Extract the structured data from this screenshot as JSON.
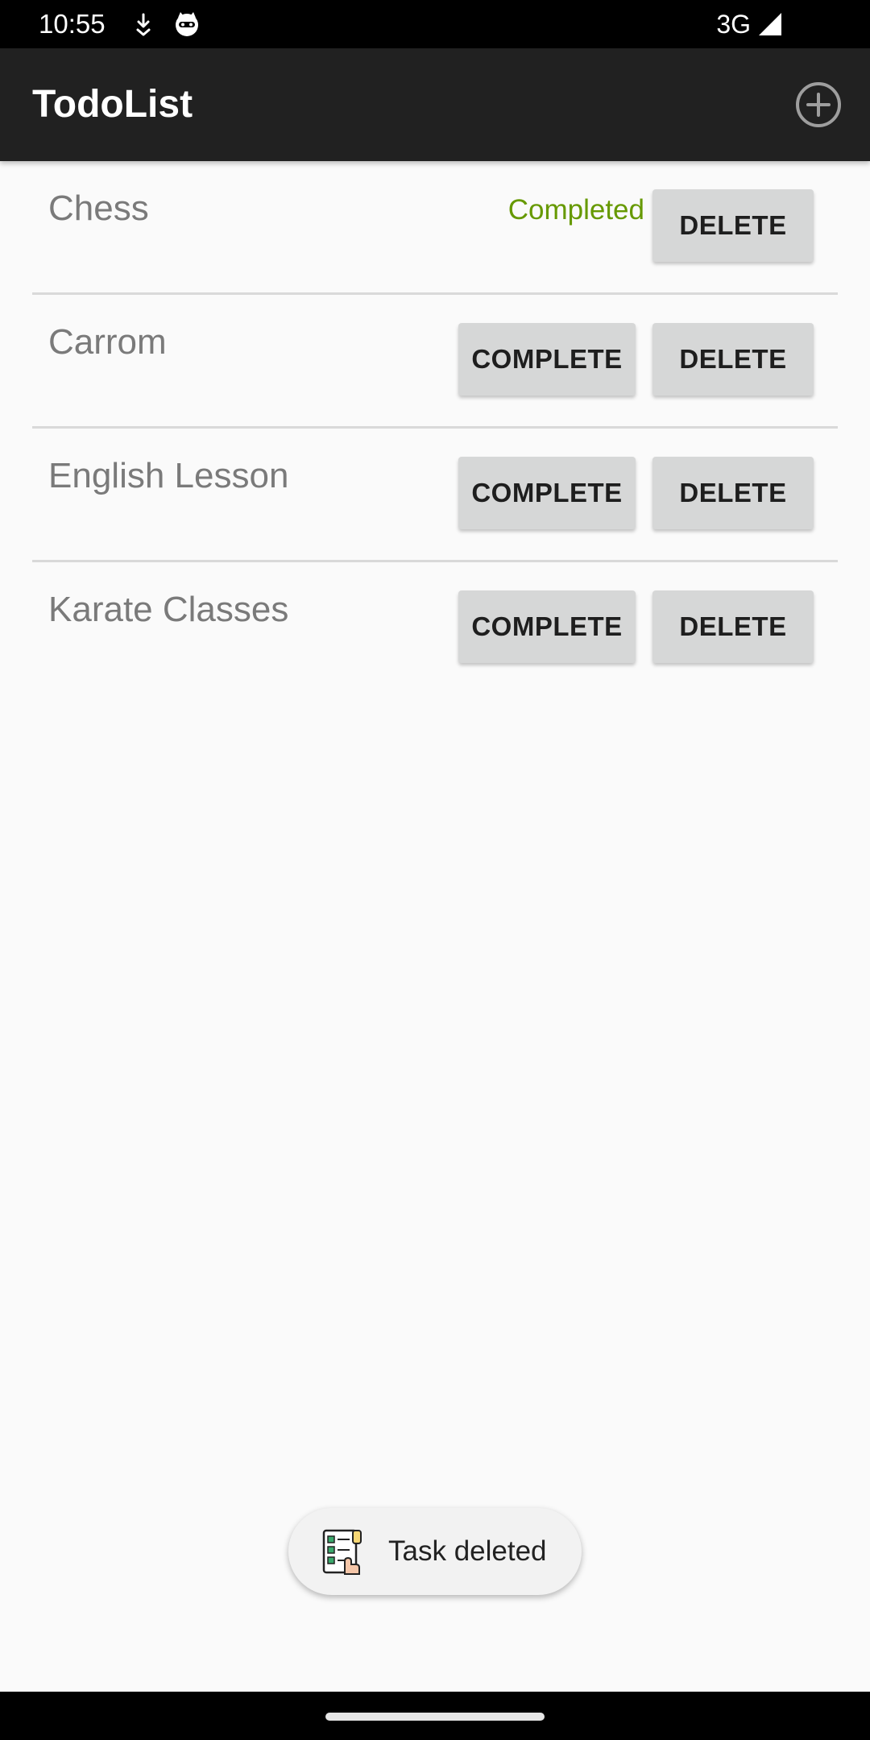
{
  "status_bar": {
    "time": "10:55",
    "network": "3G",
    "icons": [
      "download-arrow-icon",
      "cat-face-icon",
      "signal-strength-icon"
    ]
  },
  "app_bar": {
    "title": "TodoList",
    "add_icon": "add-circle-icon"
  },
  "tasks": [
    {
      "name": "Chess",
      "status_label": "Completed",
      "delete_label": "DELETE"
    },
    {
      "name": "Carrom",
      "complete_label": "COMPLETE",
      "delete_label": "DELETE"
    },
    {
      "name": "English Lesson",
      "complete_label": "COMPLETE",
      "delete_label": "DELETE"
    },
    {
      "name": "Karate Classes",
      "complete_label": "COMPLETE",
      "delete_label": "DELETE"
    }
  ],
  "toast": {
    "message": "Task deleted",
    "icon": "checklist-icon"
  },
  "colors": {
    "app_bar": "#212121",
    "completed": "#669900",
    "button": "#d6d7d7",
    "background": "#fafafa"
  }
}
